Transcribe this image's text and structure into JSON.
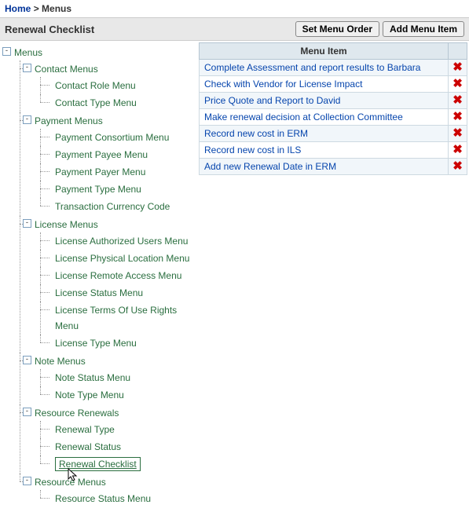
{
  "breadcrumb": {
    "home": "Home",
    "sep": ">",
    "current": "Menus"
  },
  "header": {
    "title": "Renewal Checklist",
    "set_order_btn": "Set Menu Order",
    "add_item_btn": "Add Menu Item"
  },
  "tree": {
    "root": "Menus",
    "contact": {
      "label": "Contact Menus",
      "role": "Contact Role Menu",
      "type": "Contact Type Menu"
    },
    "payment": {
      "label": "Payment Menus",
      "consortium": "Payment Consortium Menu",
      "payee": "Payment Payee Menu",
      "payer": "Payment Payer Menu",
      "type": "Payment Type Menu",
      "currency": "Transaction Currency Code"
    },
    "license": {
      "label": "License Menus",
      "auth_users": "License Authorized Users Menu",
      "phys_loc": "License Physical Location Menu",
      "remote": "License Remote Access Menu",
      "status": "License Status Menu",
      "terms": "License Terms Of Use Rights Menu",
      "type": "License Type Menu"
    },
    "note": {
      "label": "Note Menus",
      "status": "Note Status Menu",
      "type": "Note Type Menu"
    },
    "renewals": {
      "label": "Resource Renewals",
      "type": "Renewal Type",
      "status": "Renewal Status",
      "checklist": "Renewal Checklist"
    },
    "resource": {
      "label": "Resource Menus",
      "status": "Resource Status Menu"
    }
  },
  "table": {
    "header": "Menu Item",
    "items": [
      "Complete Assessment and report results to Barbara",
      "Check with Vendor for License Impact",
      "Price Quote and Report to David",
      "Make renewal decision at Collection Committee",
      "Record new cost in ERM",
      "Record new cost in ILS",
      "Add new Renewal Date in ERM"
    ]
  },
  "toggle_minus": "-"
}
